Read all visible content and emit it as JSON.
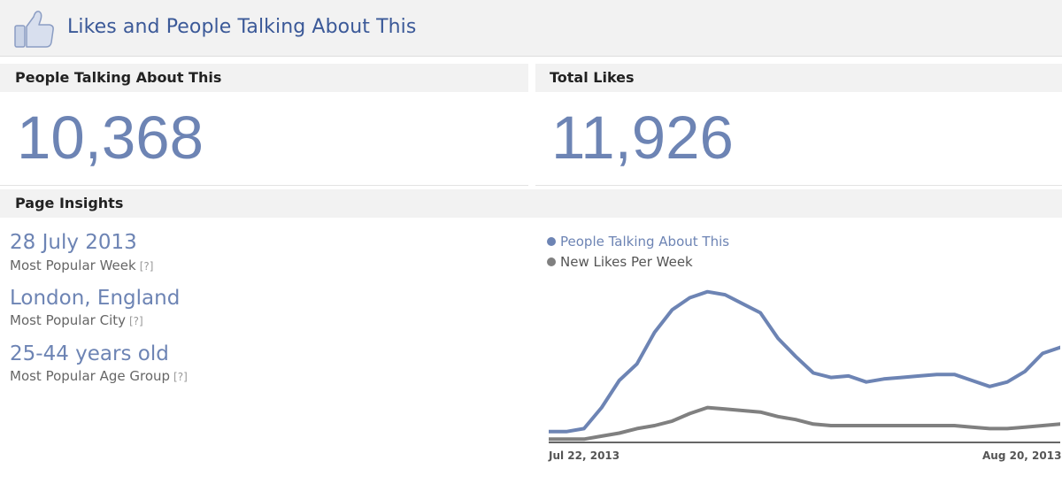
{
  "header": {
    "title": "Likes and People Talking About This",
    "icon": "thumbs-up-icon"
  },
  "talking": {
    "label": "People Talking About This",
    "value": "10,368"
  },
  "likes": {
    "label": "Total Likes",
    "value": "11,926"
  },
  "insights": {
    "label": "Page Insights",
    "help": "[?]",
    "stats": [
      {
        "value": "28 July 2013",
        "label": "Most Popular Week"
      },
      {
        "value": "London, England",
        "label": "Most Popular City"
      },
      {
        "value": "25-44 years old",
        "label": "Most Popular Age Group"
      }
    ]
  },
  "colors": {
    "accent": "#6d84b4",
    "secondary": "#808080",
    "header_text": "#3b5998"
  },
  "chart_data": {
    "type": "line",
    "x_start_label": "Jul 22, 2013",
    "x_end_label": "Aug 20, 2013",
    "x_range": [
      "Jul 22, 2013",
      "Aug 20, 2013"
    ],
    "ylim": [
      0,
      100
    ],
    "legend_position": "top-left",
    "grid": false,
    "series": [
      {
        "name": "People Talking About This",
        "color": "#6d84b4",
        "values": [
          6,
          6,
          8,
          22,
          40,
          51,
          72,
          87,
          95,
          99,
          97,
          91,
          85,
          68,
          56,
          45,
          42,
          43,
          39,
          41,
          42,
          43,
          44,
          44,
          40,
          36,
          39,
          46,
          58,
          62
        ]
      },
      {
        "name": "New Likes Per Week",
        "color": "#808080",
        "values": [
          1,
          1,
          1,
          3,
          5,
          8,
          10,
          13,
          18,
          22,
          21,
          20,
          19,
          16,
          14,
          11,
          10,
          10,
          10,
          10,
          10,
          10,
          10,
          10,
          9,
          8,
          8,
          9,
          10,
          11
        ]
      }
    ]
  }
}
